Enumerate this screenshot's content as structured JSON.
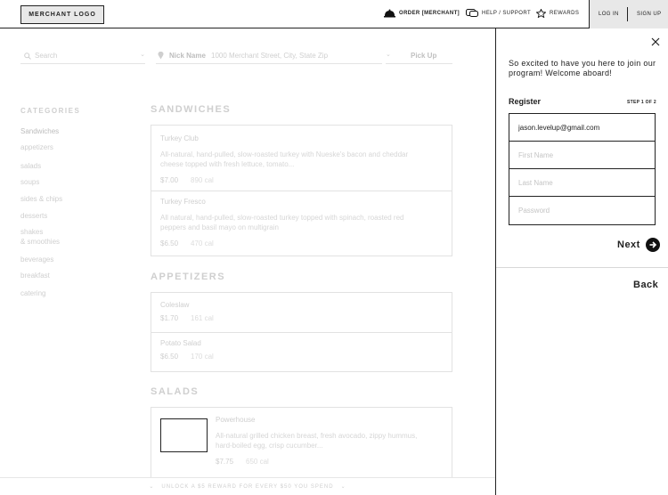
{
  "header": {
    "logo": "MERCHANT LOGO",
    "order": "ORDER [MERCHANT]",
    "help": "HELP / SUPPORT",
    "rewards": "REWARDS",
    "login": "LOG IN",
    "signup": "SIGN UP"
  },
  "toolbar": {
    "search_placeholder": "Search",
    "location_name": "Nick Name",
    "location_address": "1000 Merchant Street, City, State Zip",
    "pickup": "Pick Up"
  },
  "categories": {
    "title": "CATEGORIES",
    "items": [
      "Sandwiches",
      "appetizers",
      "salads",
      "soups",
      "sides & chips",
      "desserts",
      "shakes",
      "& smoothies",
      "beverages",
      "breakfast",
      "catering"
    ]
  },
  "menu": {
    "sandwiches": {
      "title": "SANDWICHES",
      "items": [
        {
          "name": "Turkey Club",
          "desc1": "All-natural, hand-pulled, slow-roasted turkey with Nueske's bacon and cheddar",
          "desc2": "cheese topped with fresh lettuce, tomato...",
          "price": "$7.00",
          "cal": "890 cal"
        },
        {
          "name": "Turkey Fresco",
          "desc1": "All natural, hand-pulled, slow-roasted turkey topped with spinach, roasted red",
          "desc2": "peppers and basil mayo on multigrain",
          "price": "$6.50",
          "cal": "470 cal"
        }
      ]
    },
    "appetizers": {
      "title": "APPETIZERS",
      "items": [
        {
          "name": "Coleslaw",
          "price": "$1.70",
          "cal": "161 cal"
        },
        {
          "name": "Potato Salad",
          "price": "$6.50",
          "cal": "170 cal"
        }
      ]
    },
    "salads": {
      "title": "SALADS",
      "items": [
        {
          "name": "Powerhouse",
          "desc1": "All-natural grilled chicken breast, fresh avocado, zippy hummus,",
          "desc2": "hard-boiled egg, crisp cucumber...",
          "price": "$7.75",
          "cal": "650 cal"
        }
      ]
    }
  },
  "banner": "UNLOCK A $5 REWARD FOR EVERY $50 YOU SPEND",
  "panel": {
    "welcome": "So excited to have you here to join our program! Welcome aboard!",
    "register": "Register",
    "step": "STEP 1 OF 2",
    "email_value": "jason.levelup@gmail.com",
    "first_name_placeholder": "First Name",
    "last_name_placeholder": "Last Name",
    "password_placeholder": "Password",
    "next": "Next",
    "back": "Back"
  },
  "icons": [
    "close-icon",
    "arrow-right-icon",
    "cloche-icon",
    "chat-icon",
    "star-icon",
    "search-icon",
    "location-pin-icon",
    "chevron-down-icon"
  ]
}
